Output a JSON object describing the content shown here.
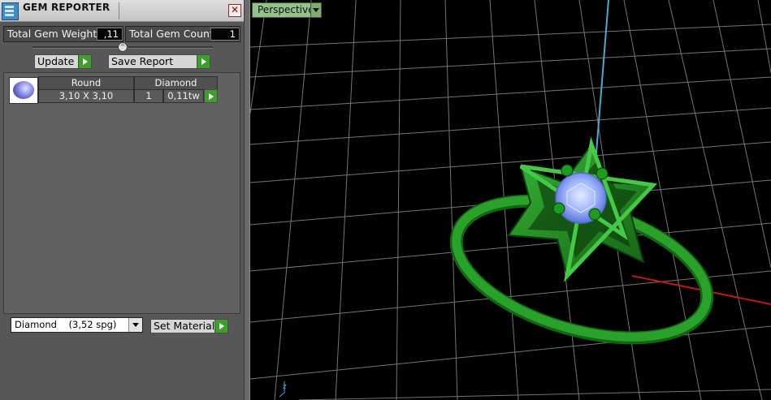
{
  "panel": {
    "title": "GEM REPORTER",
    "close_glyph": "✕",
    "total_gem_weight_label": "Total Gem Weight",
    "total_gem_weight_value": ",11",
    "total_gem_count_label": "Total Gem Count",
    "total_gem_count_value": "1",
    "update_label": "Update",
    "save_report_label": "Save Report",
    "table": {
      "headers": [
        "Round",
        "Diamond"
      ],
      "row": {
        "size": "3,10 X 3,10",
        "count": "1",
        "weight": "0,11tw"
      }
    },
    "material_select": "Diamond    (3,52 spg)",
    "set_material_label": "Set Material"
  },
  "viewport": {
    "view_label": "Perspective",
    "axis_label": "z",
    "colors": {
      "grid": "#8a8a8a",
      "ring": "#1e8c1e",
      "stone": "#9fb4ff",
      "axis_x": "#c01818",
      "axis_z": "#4aa8d8"
    }
  }
}
